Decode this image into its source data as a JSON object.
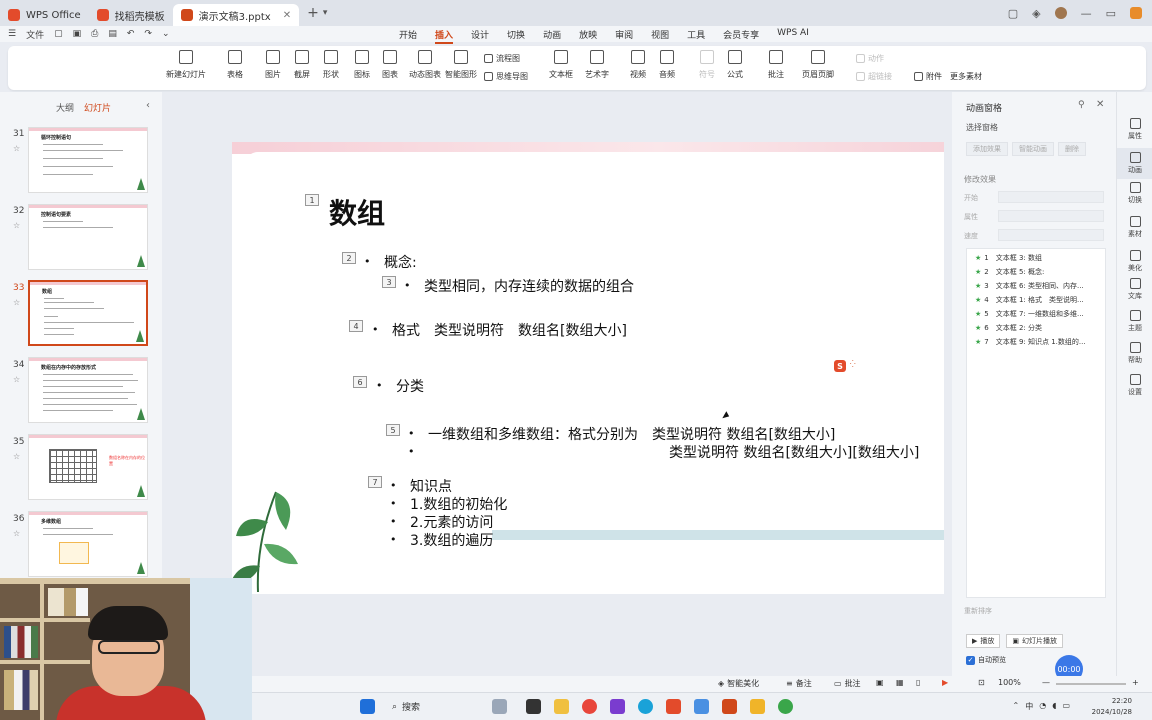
{
  "titlebar": {
    "tabs": [
      {
        "label": "WPS Office",
        "color": "#e34b2b"
      },
      {
        "label": "找稻壳模板",
        "color": "#e34b2b"
      },
      {
        "label": "演示文稿3.pptx",
        "color": "#d0481a"
      }
    ],
    "new_tab": "+",
    "new_tab_menu": "▾"
  },
  "menu": {
    "file": "文件",
    "tabs": [
      "开始",
      "插入",
      "设计",
      "切换",
      "动画",
      "放映",
      "审阅",
      "视图",
      "工具",
      "会员专享",
      "WPS AI"
    ],
    "active_tab": "插入"
  },
  "ribbon": {
    "buttons": [
      "新建幻灯片",
      "表格",
      "图片",
      "截屏",
      "形状",
      "图标",
      "图表",
      "动态图表",
      "智能图形",
      "文本框",
      "艺术字",
      "视频",
      "音频",
      "符号",
      "公式",
      "批注",
      "页眉页脚",
      "附件",
      "更多素材"
    ],
    "small": [
      "流程图",
      "思维导图",
      "动作",
      "超链接"
    ]
  },
  "leftpanel": {
    "tab_outline": "大纲",
    "tab_slides": "幻灯片",
    "thumbs": [
      {
        "num": "31",
        "title": "循环控制语句"
      },
      {
        "num": "32",
        "title": "控制语句要素"
      },
      {
        "num": "33",
        "title": "数组"
      },
      {
        "num": "34",
        "title": "数组在内存中的存放形式"
      },
      {
        "num": "35",
        "title": ""
      },
      {
        "num": "36",
        "title": "多维数组"
      }
    ],
    "selected": "33",
    "thumb35_note": "数组名称在内存的位置"
  },
  "slide": {
    "title": "数组",
    "tags": [
      "1",
      "2",
      "3",
      "4",
      "6",
      "5",
      "7"
    ],
    "concept": "概念:",
    "concept_detail": "类型相同，内存连续的数据的组合",
    "format": "格式　类型说明符　数组名[数组大小]",
    "category": "分类",
    "category_detail_1": "一维数组和多维数组：格式分别为　类型说明符 数组名[数组大小]",
    "category_detail_2": "类型说明符 数组名[数组大小][数组大小]",
    "knowledge": "知识点",
    "k1": "1.数组的初始化",
    "k2": "2.元素的访问",
    "k3": "3.数组的遍历",
    "bullet": "•"
  },
  "animpanel": {
    "title": "动画窗格",
    "select_pane": "选择窗格",
    "add_effect": "添加效果",
    "smart_anim": "智能动画",
    "delete": "删除",
    "modify": "修改效果",
    "start": "开始",
    "property": "属性",
    "speed": "速度",
    "items": [
      "1　文本框 3: 数组",
      "2　文本框 5: 概念:",
      "3　文本框 6: 类型相同、内存...",
      "4　文本框 1: 格式　类型说明...",
      "5　文本框 7: 一维数组和多维...",
      "6　文本框 2: 分类",
      "7　文本框 9: 知识点 1.数组的..."
    ],
    "reorder": "重新排序",
    "play": "播放",
    "slideshow": "幻灯片播放",
    "autopreview": "自动预览"
  },
  "rail": [
    "属性",
    "动画",
    "切换",
    "素材",
    "美化",
    "文库",
    "主题",
    "帮助",
    "设置"
  ],
  "timer": "00:00",
  "statusbar": {
    "smart_beautify": "智能美化",
    "notes": "备注",
    "comments": "批注",
    "zoom": "100%"
  },
  "taskbar": {
    "search": "搜索",
    "time": "22:20",
    "date": "2024/10/28",
    "lang": "中"
  }
}
